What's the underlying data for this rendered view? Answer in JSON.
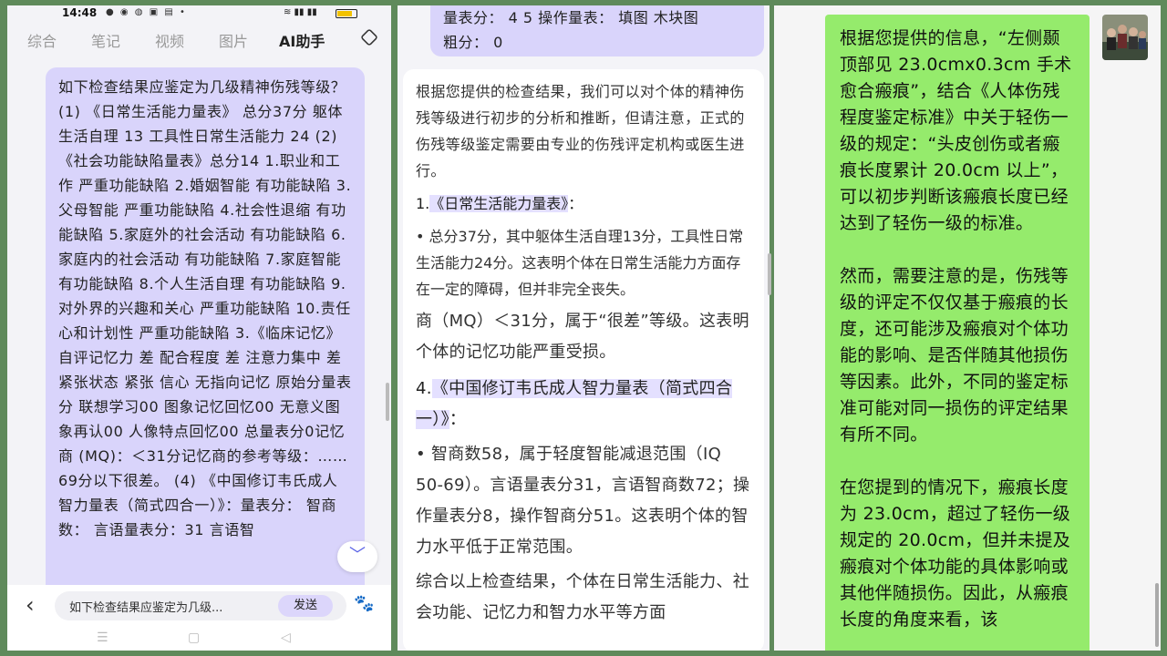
{
  "status": {
    "time": "14:48"
  },
  "tabs": [
    "综合",
    "笔记",
    "视频",
    "图片",
    "AI助手"
  ],
  "left_question": "如下检查结果应鉴定为几级精神伤残等级？ (1) 《日常生活能力量表》 总分37分 躯体生活自理 13 工具性日常生活能力 24 (2) 《社会功能缺陷量表》总分14 1.职业和工作 严重功能缺陷 2.婚姻智能 有功能缺陷 3.父母智能 严重功能缺陷 4.社会性退缩 有功能缺陷 5.家庭外的社会活动 有功能缺陷 6.家庭内的社会活动 有功能缺陷 7.家庭智能 有功能缺陷 8.个人生活自理 有功能缺陷 9.对外界的兴趣和关心 严重功能缺陷 10.责任心和计划性 严重功能缺陷 3.《临床记忆》 自评记忆力 差 配合程度 差 注意力集中 差 紧张状态 紧张 信心 无指向记忆 原始分量表分 联想学习00 图象记忆回忆00 无意义图象再认00 人像特点回忆00 总量表分0记忆商 (MQ)：＜31分记忆商的参考等级：……69分以下很差。 (4) 《中国修订韦氏成人智力量表（简式四合一）》：量表分： 智商数： 言语量表分：31 言语智",
  "input": {
    "text": "如下检查结果应鉴定为几级...",
    "send": "发送"
  },
  "middle": {
    "question_tail": [
      "量表分： 4 5 操作量表： 填图 木块图",
      "粗分： 0"
    ],
    "intro": "根据您提供的检查结果，我们可以对个体的精神伤残等级进行初步的分析和推断，但请注意，正式的伤残等级鉴定需要由专业的伤残评定机构或医生进行。",
    "h1_num": "1.",
    "h1": "《日常生活能力量表》",
    "h1_colon": "：",
    "b1": "总分37分，其中躯体生活自理13分，工具性日常生活能力24分。这表明个体在日常生活能力方面存在一定的障碍，但并非完全丧失。",
    "mq": "商（MQ）＜31分，属于“很差”等级。这表明个体的记忆功能严重受损。",
    "h4_num": "4.",
    "h4": "《中国修订韦氏成人智力量表（简式四合一）》",
    "h4_colon": "：",
    "b4": "智商数58，属于轻度智能减退范围（IQ 50-69）。言语量表分31，言语智商数72；操作量表分8，操作智商分51。这表明个体的智力水平低于正常范围。",
    "summary": "综合以上检查结果，个体在日常生活能力、社会功能、记忆力和智力水平等方面"
  },
  "right_bubble": [
    "根据您提供的信息，“左侧颞顶部见 23.0cmx0.3cm 手术愈合瘢痕”，结合《人体伤残程度鉴定标准》中关于轻伤一级的规定：“头皮创伤或者瘢痕长度累计 20.0cm 以上”，可以初步判断该瘢痕长度已经达到了轻伤一级的标准。",
    "然而，需要注意的是，伤残等级的评定不仅仅基于瘢痕的长度，还可能涉及瘢痕对个体功能的影响、是否伴随其他损伤等因素。此外，不同的鉴定标准可能对同一损伤的评定结果有所不同。",
    "在您提到的情况下，瘢痕长度为 23.0cm，超过了轻伤一级规定的 20.0cm，但并未提及瘢痕对个体功能的具体影响或其他伴随损伤。因此，从瘢痕长度的角度来看，该"
  ]
}
